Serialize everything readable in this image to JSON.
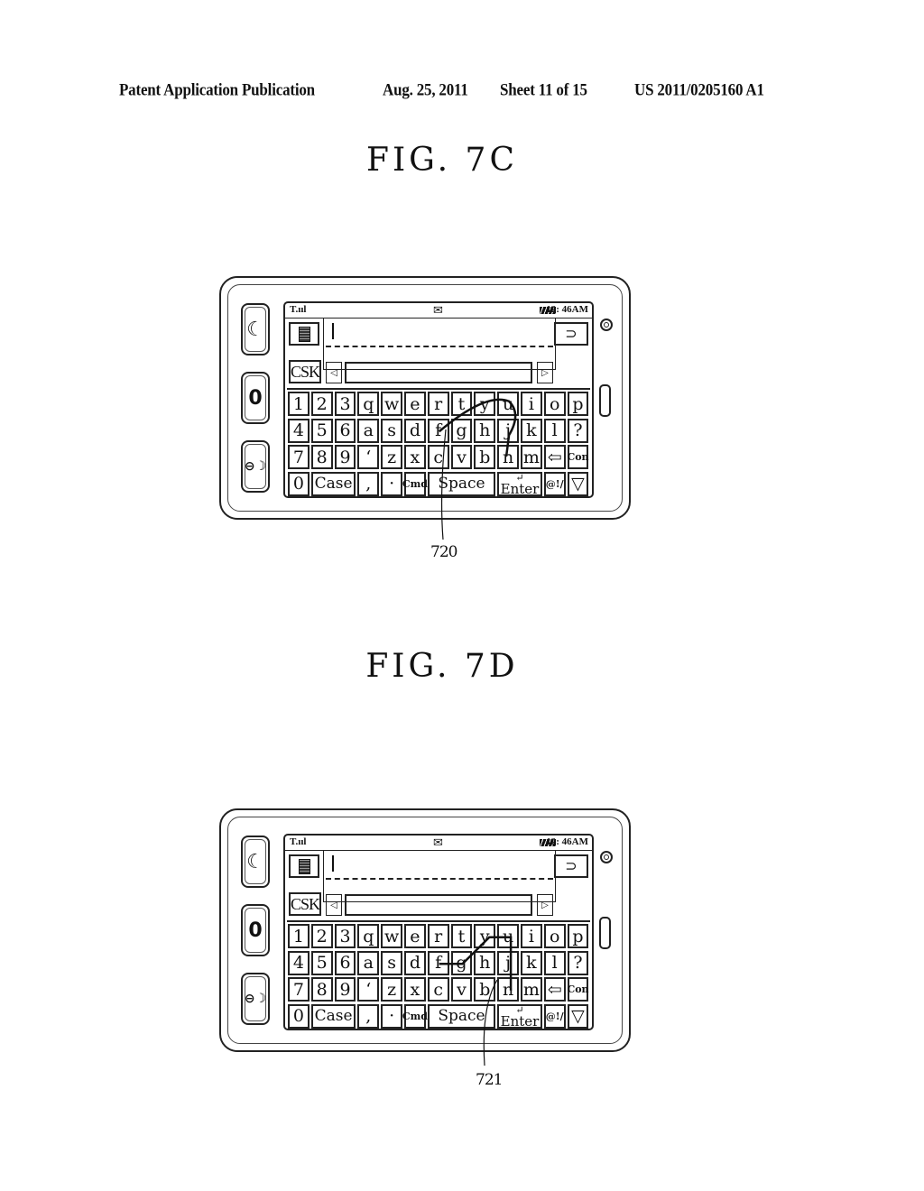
{
  "header": {
    "publication": "Patent Application Publication",
    "date": "Aug. 25, 2011",
    "sheet": "Sheet 11 of 15",
    "pub_number": "US 2011/0205160 A1"
  },
  "figures": [
    {
      "title": "FIG.  7C",
      "reference_label": "720",
      "trace_type": "curved",
      "trace_keys": [
        "f",
        "y",
        "u",
        "j",
        "n"
      ]
    },
    {
      "title": "FIG.  7D",
      "reference_label": "721",
      "trace_type": "polyline",
      "trace_keys": [
        "f",
        "g",
        "y",
        "u",
        "j",
        "n"
      ]
    }
  ],
  "device": {
    "side_buttons": [
      {
        "name": "call-icon",
        "glyph": "☎"
      },
      {
        "name": "menu-icon",
        "glyph": "0"
      },
      {
        "name": "end-call-icon",
        "glyph": "⊖"
      }
    ],
    "status_bar": {
      "signal": "T.ııl",
      "message_icon": "✉",
      "time": "12: 46AM"
    },
    "menu_icon": "menu-icon",
    "back_icon": "⊃",
    "csk_label": "CSK",
    "left_arrow": "◁",
    "right_arrow": "▷",
    "keyboard": {
      "rows": [
        [
          "1",
          "2",
          "3",
          "q",
          "w",
          "e",
          "r",
          "t",
          "y",
          "u",
          "i",
          "o",
          "p"
        ],
        [
          "4",
          "5",
          "6",
          "a",
          "s",
          "d",
          "f",
          "g",
          "h",
          "j",
          "k",
          "l",
          "?"
        ],
        [
          "7",
          "8",
          "9",
          "ʻ",
          "z",
          "x",
          "c",
          "v",
          "b",
          "n",
          "m",
          "⇦",
          "Con"
        ],
        [
          "0",
          "Case",
          ",",
          "·",
          "Cmd",
          "Space",
          "Enter",
          "@!/",
          "▽"
        ]
      ],
      "enter_glyph": "↵"
    }
  }
}
